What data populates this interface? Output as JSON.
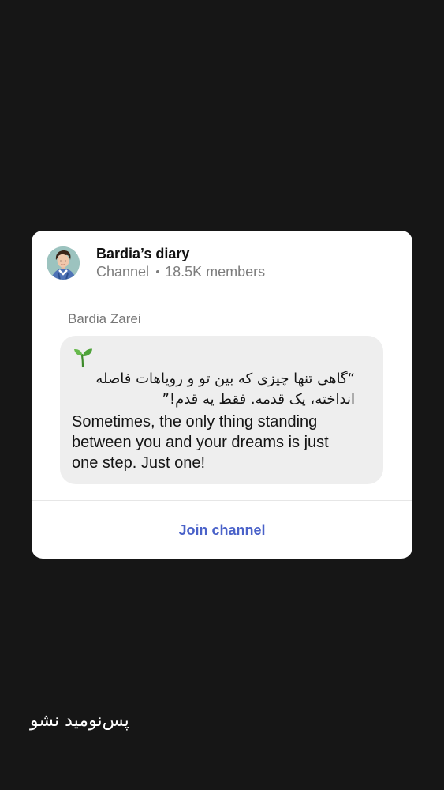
{
  "channel": {
    "title": "Bardia’s diary",
    "type_label": "Channel",
    "members": "18.5K members"
  },
  "message": {
    "sender": "Bardia Zarei",
    "emoji": "sprout-icon",
    "lines": [
      "“گاهی تنها چیزی که بین تو و رویاهات فاصله",
      "انداخته، یک قدمه. فقط یه قدم!”",
      "Sometimes, the only thing standing",
      "between you and your dreams is just",
      "one step. Just one!"
    ]
  },
  "footer": {
    "join_label": "Join channel"
  },
  "caption": "پس‌نومید نشو",
  "colors": {
    "background": "#161616",
    "card": "#ffffff",
    "bubble": "#eeeeee",
    "accent": "#4a62c9",
    "muted": "#7d7d7d"
  }
}
